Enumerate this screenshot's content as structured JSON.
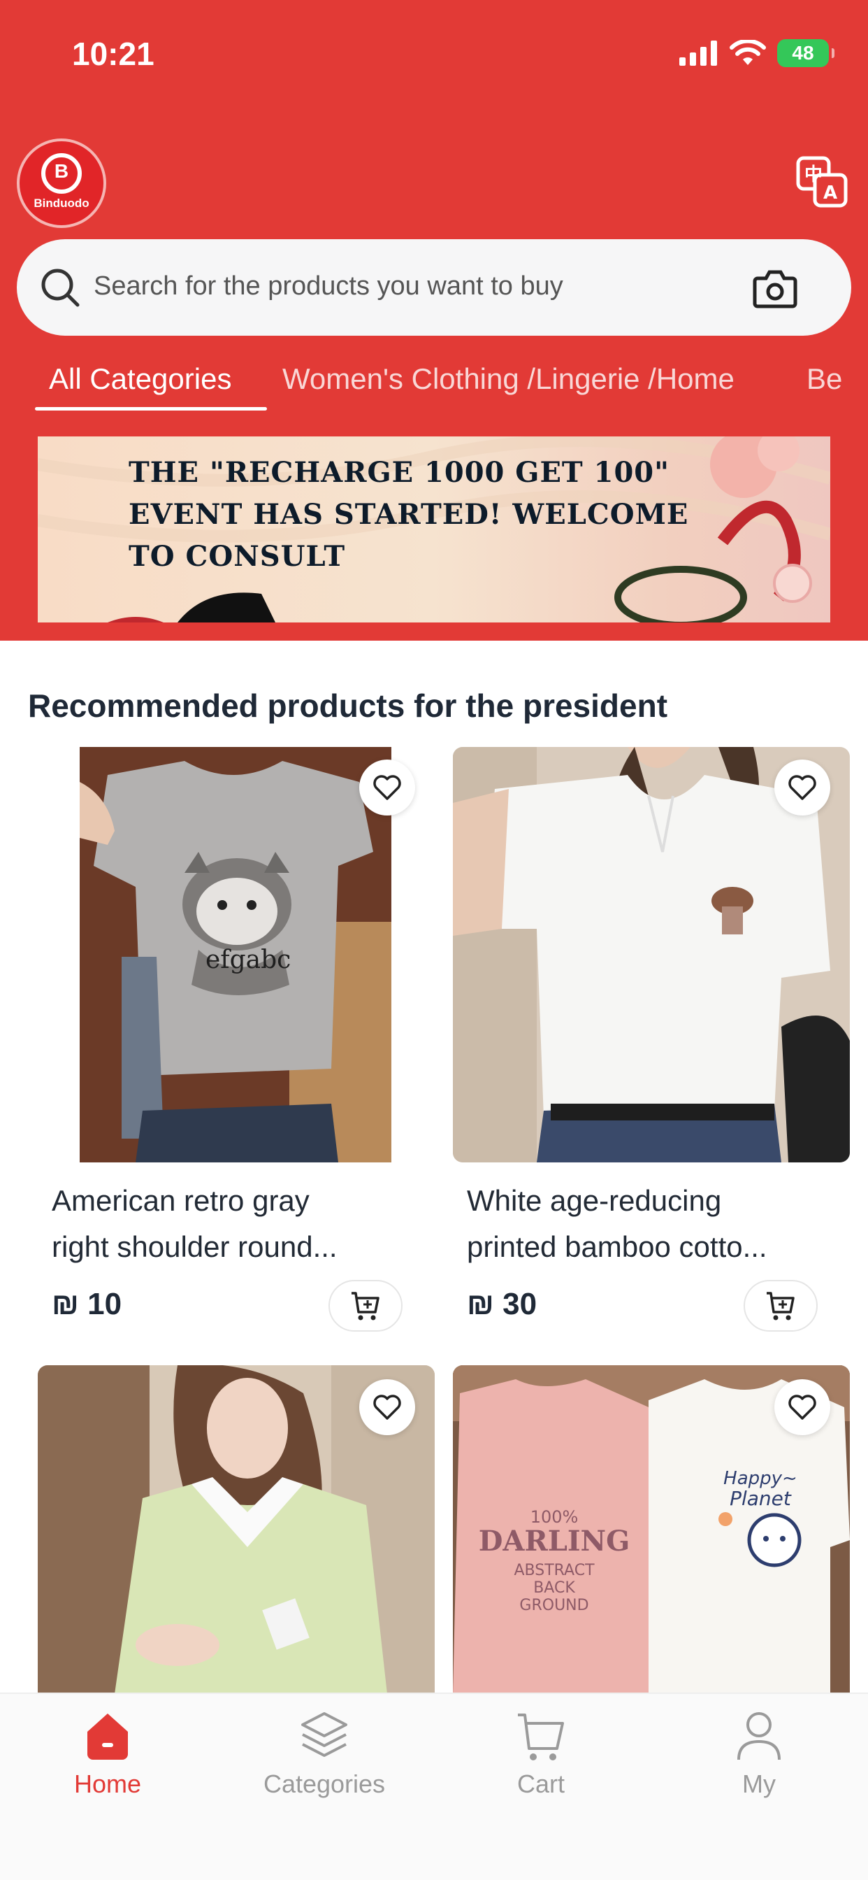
{
  "status_bar": {
    "time": "10:21",
    "battery": "48"
  },
  "brand": {
    "logo_text": "Binduodo"
  },
  "search": {
    "placeholder": "Search for the products you want to buy"
  },
  "category_tabs": [
    {
      "label": "All Categories",
      "active": true
    },
    {
      "label": "Women's Clothing /Lingerie /Home",
      "active": false
    },
    {
      "label": "Be",
      "active": false
    }
  ],
  "banner": {
    "lines": [
      "THE \"RECHARGE 1000 GET 100\"",
      "EVENT HAS STARTED! WELCOME",
      "TO CONSULT"
    ]
  },
  "section_title": "Recommended products for the president",
  "products": [
    {
      "title_line1": "American retro gray",
      "title_line2": "right shoulder round...",
      "price": "10",
      "currency": "₪",
      "image_print": "efgabc"
    },
    {
      "title_line1": "White age-reducing",
      "title_line2": "printed bamboo cotto...",
      "price": "30",
      "currency": "₪"
    },
    {
      "title_line1": "",
      "title_line2": "",
      "price": "",
      "currency": ""
    },
    {
      "title_line1": "",
      "title_line2": "",
      "price": "",
      "currency": "",
      "image_print_left": [
        "100%",
        "DARLING",
        "ABSTRACT",
        "BACK",
        "GROUND"
      ],
      "image_print_right": [
        "Happy~",
        "Planet"
      ]
    }
  ],
  "tabbar": [
    {
      "label": "Home",
      "active": true,
      "icon": "home-icon"
    },
    {
      "label": "Categories",
      "active": false,
      "icon": "layers-icon"
    },
    {
      "label": "Cart",
      "active": false,
      "icon": "cart-icon"
    },
    {
      "label": "My",
      "active": false,
      "icon": "user-icon"
    }
  ],
  "colors": {
    "brand_red": "#e23a36",
    "active_tab": "#e23a36",
    "inactive_tab": "#9a9a9a"
  }
}
